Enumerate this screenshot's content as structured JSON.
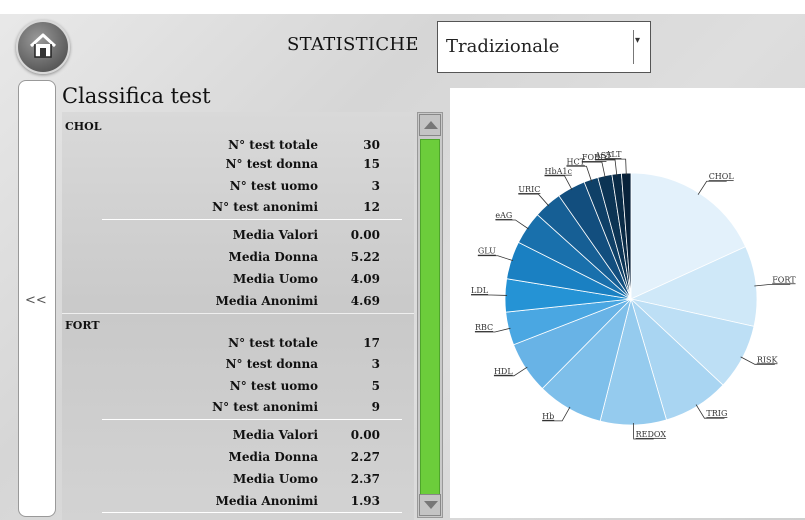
{
  "header": {
    "title": "STATISTICHE",
    "select_value": "Tradizionale",
    "select_arrow": "▾"
  },
  "sidebar": {
    "back_label": "<<"
  },
  "list": {
    "title": "Classifica test",
    "groups": [
      {
        "name": "CHOL",
        "rows": [
          {
            "label": "N° test totale",
            "value": "30"
          },
          {
            "label": "N° test donna",
            "value": "15"
          },
          {
            "label": "N° test uomo",
            "value": "3"
          },
          {
            "label": "N° test anonimi",
            "value": "12"
          },
          {
            "label": "Media Valori",
            "value": "0.00"
          },
          {
            "label": "Media Donna",
            "value": "5.22"
          },
          {
            "label": "Media Uomo",
            "value": "4.09"
          },
          {
            "label": "Media Anonimi",
            "value": "4.69"
          }
        ]
      },
      {
        "name": "FORT",
        "rows": [
          {
            "label": "N° test totale",
            "value": "17"
          },
          {
            "label": "N° test donna",
            "value": "3"
          },
          {
            "label": "N° test uomo",
            "value": "5"
          },
          {
            "label": "N° test anonimi",
            "value": "9"
          },
          {
            "label": "Media Valori",
            "value": "0.00"
          },
          {
            "label": "Media Donna",
            "value": "2.27"
          },
          {
            "label": "Media Uomo",
            "value": "2.37"
          },
          {
            "label": "Media Anonimi",
            "value": "1.93"
          }
        ]
      }
    ]
  },
  "chart_data": {
    "type": "pie",
    "title": "",
    "slices": [
      {
        "label": "CHOL",
        "value": 30,
        "color": "#e3f1fb"
      },
      {
        "label": "FORT",
        "value": 17,
        "color": "#cfe8f8"
      },
      {
        "label": "RISK",
        "value": 14,
        "color": "#bddff5"
      },
      {
        "label": "TRIG",
        "value": 14,
        "color": "#a9d5f2"
      },
      {
        "label": "REDOX",
        "value": 14,
        "color": "#95cbee"
      },
      {
        "label": "Hb",
        "value": 14,
        "color": "#7ebfea"
      },
      {
        "label": "HDL",
        "value": 11,
        "color": "#68b3e6"
      },
      {
        "label": "RBC",
        "value": 7,
        "color": "#4aa7e2"
      },
      {
        "label": "LDL",
        "value": 7,
        "color": "#2593d5"
      },
      {
        "label": "GLU",
        "value": 8,
        "color": "#1a80c2"
      },
      {
        "label": "eAG",
        "value": 7,
        "color": "#1970ac"
      },
      {
        "label": "URIC",
        "value": 6,
        "color": "#165f95"
      },
      {
        "label": "HbA1c",
        "value": 6,
        "color": "#124e7e"
      },
      {
        "label": "HCT",
        "value": 3,
        "color": "#0f4067"
      },
      {
        "label": "FORD",
        "value": 3,
        "color": "#0c3454"
      },
      {
        "label": "AST",
        "value": 2,
        "color": "#0a2b46"
      },
      {
        "label": "ALT",
        "value": 2,
        "color": "#08223a"
      }
    ]
  }
}
